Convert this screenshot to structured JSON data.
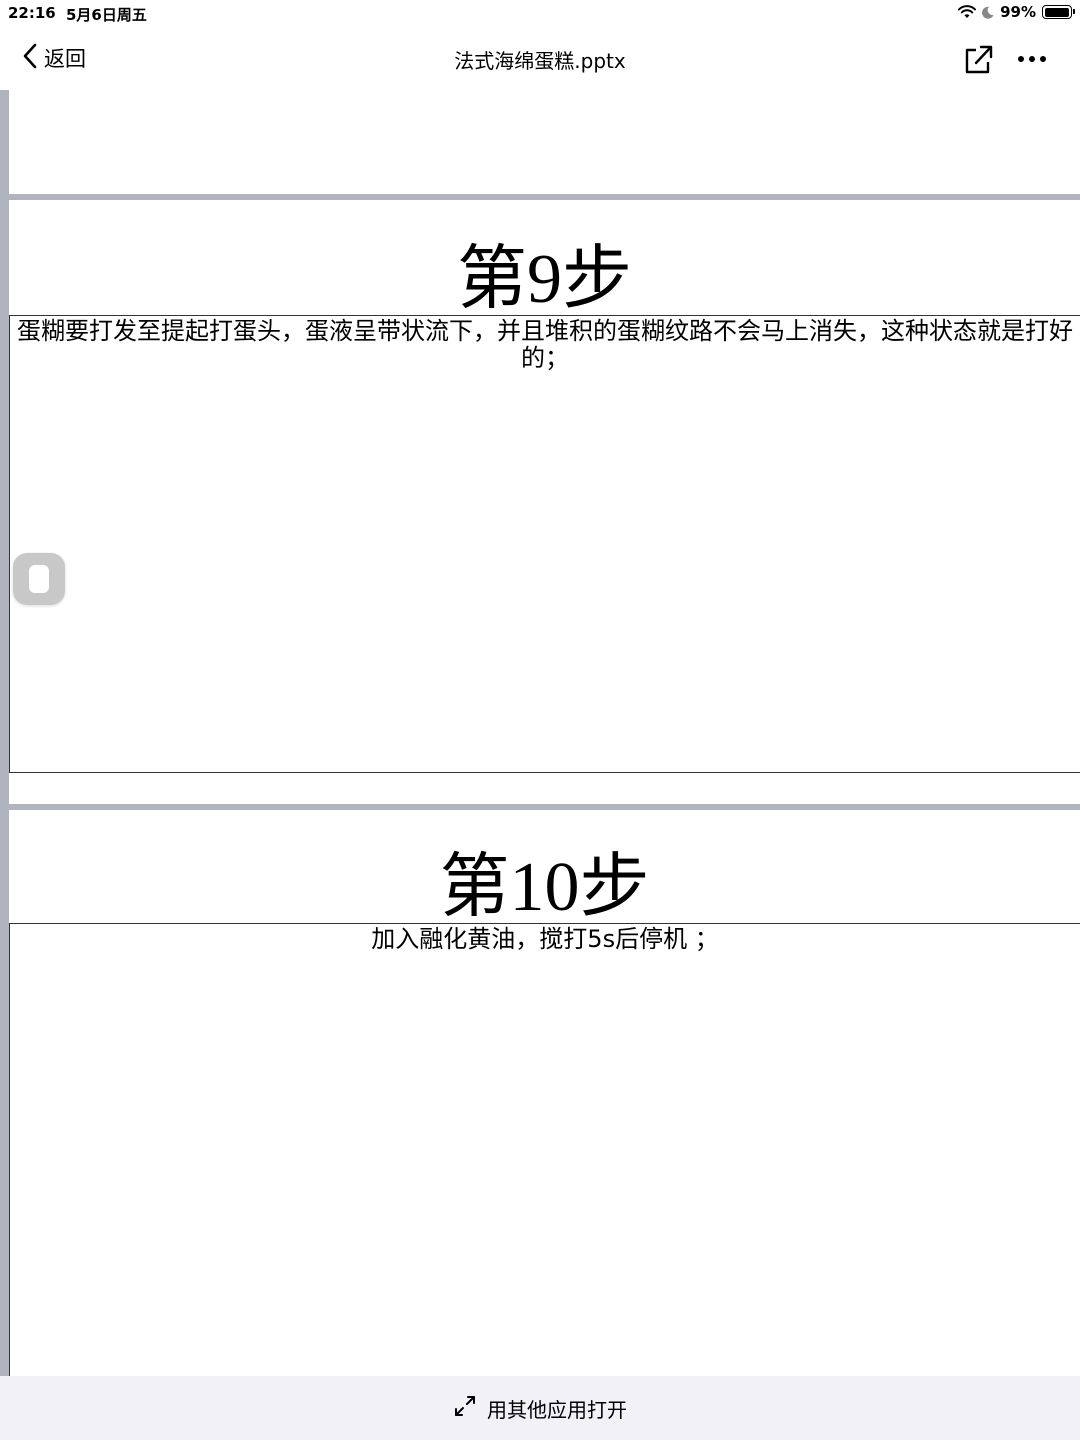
{
  "status_bar": {
    "time": "22:16",
    "date": "5月6日周五",
    "battery_percent_label": "99%",
    "battery_level": 0.99
  },
  "nav": {
    "back_label": "返回",
    "title": "法式海绵蛋糕.pptx",
    "share_icon": "share-icon",
    "more_icon": "more-icon"
  },
  "slides": [
    {
      "title": "第9步",
      "text": "蛋糊要打发至提起打蛋头，蛋液呈带状流下，并且堆积的蛋糊纹路不会马上消失，这种状态就是打好的；"
    },
    {
      "title": "第10步",
      "text": "加入融化黄油，搅打5s后停机 ；"
    }
  ],
  "bottom_bar": {
    "open_with_label": "用其他应用打开",
    "icon": "expand-icon"
  },
  "colors": {
    "slide_separator": "#b0b4be",
    "bottom_bar_bg": "#f2f2f6"
  }
}
